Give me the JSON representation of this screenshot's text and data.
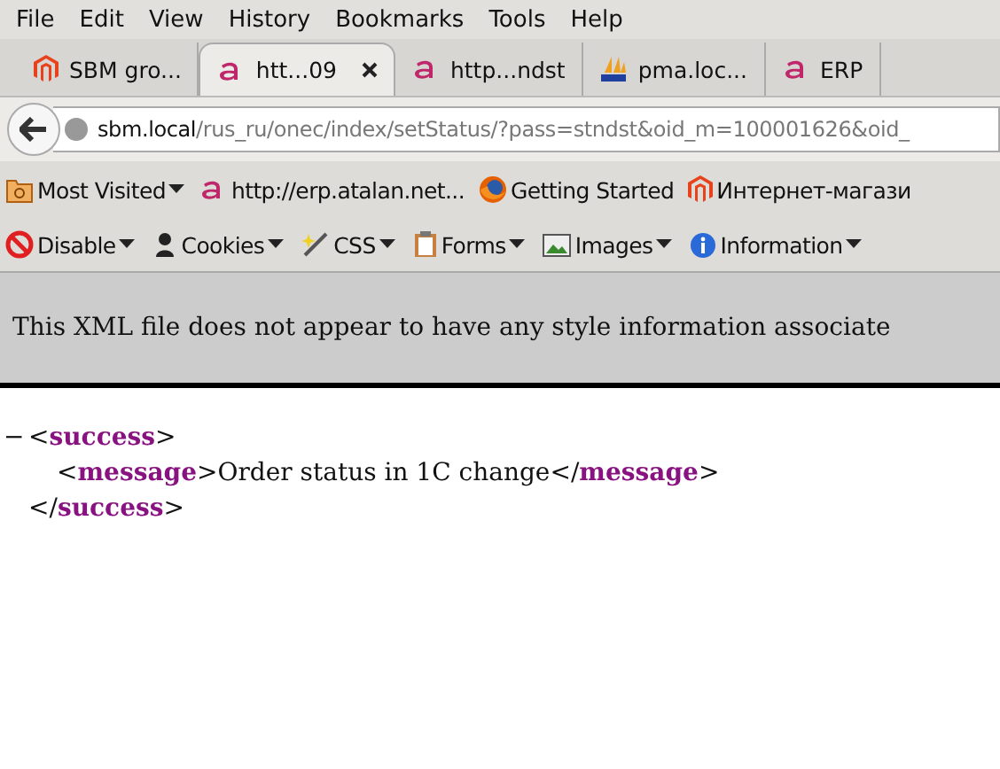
{
  "menu": [
    "File",
    "Edit",
    "View",
    "History",
    "Bookmarks",
    "Tools",
    "Help"
  ],
  "tabs": [
    {
      "kind": "magento",
      "label": "SBM gro...",
      "selected": false
    },
    {
      "kind": "atalan",
      "label": "htt...09",
      "selected": true
    },
    {
      "kind": "atalan",
      "label": "http...ndst",
      "selected": false
    },
    {
      "kind": "pma",
      "label": "pma.loc...",
      "selected": false
    },
    {
      "kind": "atalan",
      "label": "ERP",
      "selected": false
    }
  ],
  "url": {
    "host": "sbm.local",
    "path": "/rus_ru/onec/index/setStatus/?pass=stndst&oid_m=100001626&oid_"
  },
  "bookmarks": [
    {
      "kind": "folder",
      "label": "Most Visited",
      "dropdown": true
    },
    {
      "kind": "atalan",
      "label": "http://erp.atalan.net...",
      "dropdown": false
    },
    {
      "kind": "firefox",
      "label": "Getting Started",
      "dropdown": false
    },
    {
      "kind": "magento",
      "label": "Интернет-магази",
      "dropdown": false
    }
  ],
  "webdev": [
    {
      "kind": "disable",
      "label": "Disable"
    },
    {
      "kind": "cookie",
      "label": "Cookies"
    },
    {
      "kind": "wand",
      "label": "CSS"
    },
    {
      "kind": "clipboard",
      "label": "Forms"
    },
    {
      "kind": "image",
      "label": "Images"
    },
    {
      "kind": "info",
      "label": "Information"
    }
  ],
  "xml_notice": "This XML file does not appear to have any style information associate",
  "xml": [
    {
      "toggle": "−",
      "tokens": [
        {
          "kind": "punct",
          "text": "<"
        },
        {
          "kind": "tag",
          "text": "success"
        },
        {
          "kind": "punct",
          "text": ">"
        }
      ]
    },
    {
      "tokens": [
        {
          "kind": "punct",
          "text": "<"
        },
        {
          "kind": "tag",
          "text": "message"
        },
        {
          "kind": "punct",
          "text": ">"
        },
        {
          "kind": "text",
          "text": "Order status in 1C change"
        },
        {
          "kind": "punct",
          "text": "</"
        },
        {
          "kind": "tag",
          "text": "message"
        },
        {
          "kind": "punct",
          "text": ">"
        }
      ],
      "indent": true
    },
    {
      "tokens": [
        {
          "kind": "punct",
          "text": "</"
        },
        {
          "kind": "tag",
          "text": "success"
        },
        {
          "kind": "punct",
          "text": ">"
        }
      ]
    }
  ]
}
